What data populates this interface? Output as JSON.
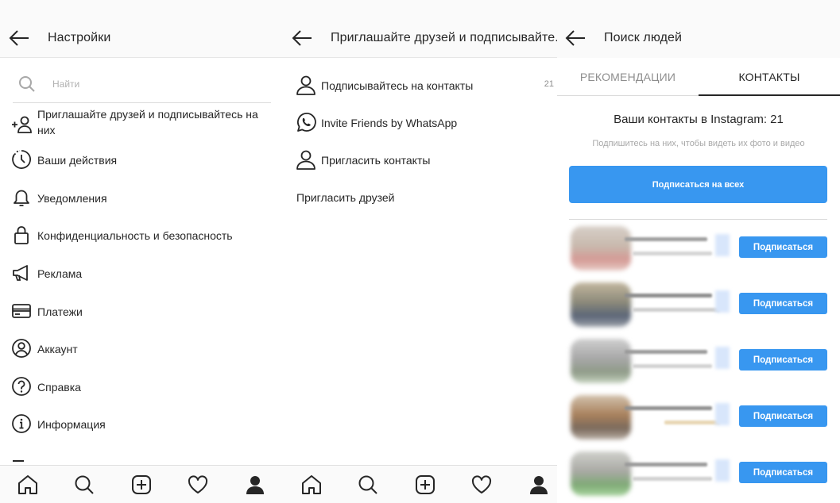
{
  "colors": {
    "accent": "#3897f0",
    "text": "#262626",
    "muted": "#8e8e8e"
  },
  "settings": {
    "title": "Настройки",
    "search_placeholder": "Найти",
    "items": [
      {
        "icon": "add-person-icon",
        "label": "Приглашайте друзей и подписывайтесь на них"
      },
      {
        "icon": "activity-icon",
        "label": "Ваши действия"
      },
      {
        "icon": "bell-icon",
        "label": "Уведомления"
      },
      {
        "icon": "lock-icon",
        "label": "Конфиденциальность и безопасность"
      },
      {
        "icon": "megaphone-icon",
        "label": "Реклама"
      },
      {
        "icon": "card-icon",
        "label": "Платежи"
      },
      {
        "icon": "account-icon",
        "label": "Аккаунт"
      },
      {
        "icon": "help-icon",
        "label": "Справка"
      },
      {
        "icon": "info-icon",
        "label": "Информация"
      }
    ]
  },
  "invite": {
    "title": "Приглашайте друзей и подписывайте...",
    "items": [
      {
        "icon": "person-icon",
        "label": "Подписывайтесь на контакты",
        "count": "21"
      },
      {
        "icon": "whatsapp-icon",
        "label": "Invite Friends by WhatsApp"
      },
      {
        "icon": "person-icon",
        "label": "Пригласить контакты"
      }
    ],
    "plain_item": "Пригласить друзей"
  },
  "discover": {
    "title": "Поиск людей",
    "tabs": [
      "РЕКОМЕНДАЦИИ",
      "КОНТАКТЫ"
    ],
    "active_tab": "КОНТАКТЫ",
    "contacts_heading": "Ваши контакты в Instagram: 21",
    "contacts_subtext": "Подпишитесь на них, чтобы видеть их фото и видео",
    "follow_all_label": "Подписаться на всех",
    "follow_label": "Подписаться",
    "contacts_visible": 5
  },
  "bottom_nav": [
    "home-icon",
    "search-icon",
    "new-post-icon",
    "heart-icon",
    "profile-icon"
  ]
}
